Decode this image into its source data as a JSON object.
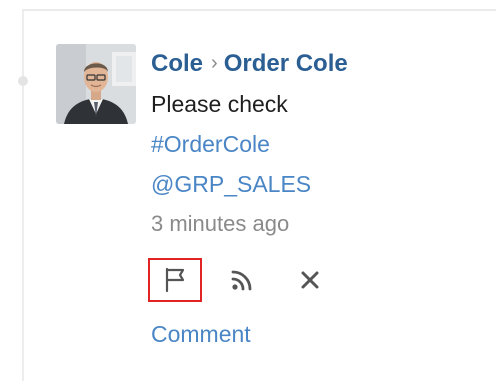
{
  "post": {
    "author": "Cole",
    "separator": "›",
    "target": "Order Cole",
    "message": "Please check",
    "hashtag": "#OrderCole",
    "mention": "@GRP_SALES",
    "time_ago": "3 minutes ago"
  },
  "actions": {
    "flag_icon": "flag-icon",
    "feed_icon": "rss-feed-icon",
    "close_icon": "close-icon",
    "comment_label": "Comment"
  },
  "colors": {
    "link": "#2b5f93",
    "tag": "#4a86c5",
    "highlight_border": "#e02323",
    "muted": "#8a8a8a"
  }
}
